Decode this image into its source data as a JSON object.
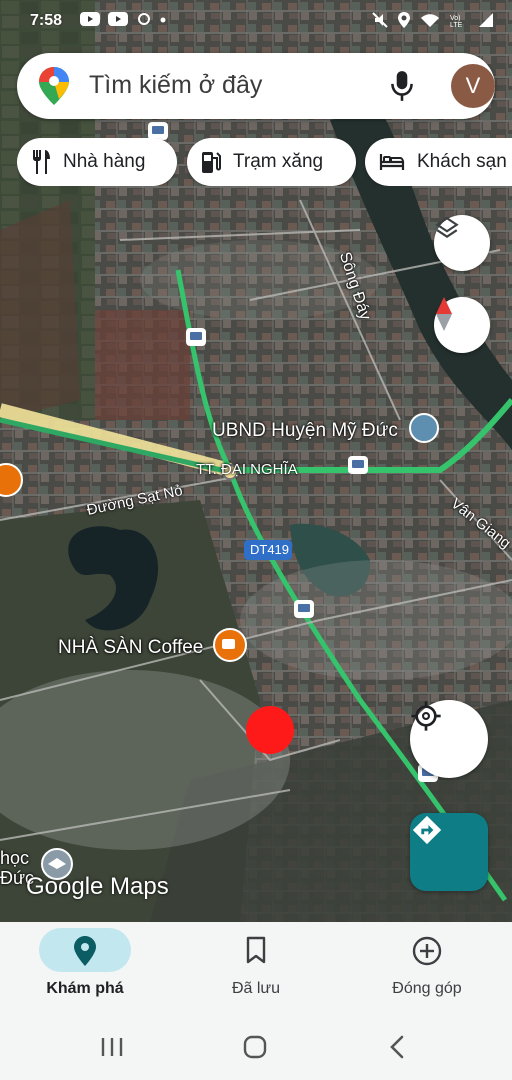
{
  "status_bar": {
    "time": "7:58"
  },
  "search": {
    "placeholder": "Tìm kiếm ở đây",
    "avatar_letter": "V"
  },
  "chips": [
    {
      "label": "Nhà hàng",
      "icon": "restaurant-icon"
    },
    {
      "label": "Trạm xăng",
      "icon": "gas-station-icon"
    },
    {
      "label": "Khách sạn",
      "icon": "hotel-icon"
    }
  ],
  "map_labels": {
    "river": "Sông Đáy",
    "ubnd": "UBND Huyện Mỹ Đức",
    "town": "TT. ĐẠI NGHĨA",
    "railway": "Đường Sạt Nỏ",
    "road_dt419": "DT419",
    "van_giang": "Vân Giang",
    "coffee": "NHÀ SÀN Coffee",
    "school_partial": "học Đức",
    "logo": "Google Maps"
  },
  "nav": [
    {
      "label": "Khám phá",
      "icon": "explore-pin-icon",
      "active": true
    },
    {
      "label": "Đã lưu",
      "icon": "bookmark-icon",
      "active": false
    },
    {
      "label": "Đóng góp",
      "icon": "add-circle-icon",
      "active": false
    }
  ],
  "colors": {
    "accent": "#0f7d86",
    "active_pill": "#c2e7ee",
    "marker": "#ff1a1a",
    "road_green": "#35c46b",
    "road_yellow": "#f2e39a"
  }
}
